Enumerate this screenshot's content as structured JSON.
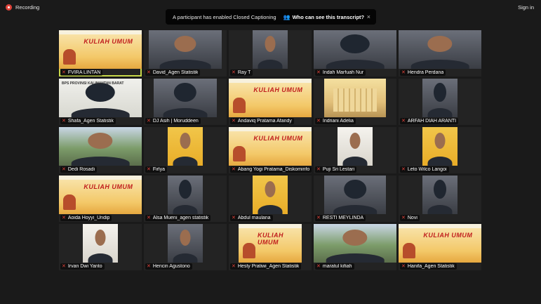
{
  "topbar": {
    "recording_label": "Recording",
    "signin_label": "Sign in"
  },
  "banner": {
    "message": "A participant has enabled Closed Captioning",
    "link_label": "Who can see this transcript?",
    "close_glyph": "×"
  },
  "colors": {
    "background": "#1a1a1a",
    "recording": "#e0433a",
    "active_speaker": "#c8d84a",
    "muted_mic": "#e0433a"
  },
  "icons": {
    "recording": "recording-dot-icon",
    "transcript_link": "people-icon",
    "muted": "microphone-muted-icon"
  },
  "poster": {
    "title": "KULIAH UMUM"
  },
  "bps": {
    "text": "BPS PROVINSI KALIMANTAN BARAT"
  },
  "participants": [
    {
      "name": "FVIRA LINTAN",
      "kind": "poster",
      "active": true
    },
    {
      "name": "David_Agen Statistik",
      "kind": "person"
    },
    {
      "name": "Ray T",
      "kind": "person"
    },
    {
      "name": "Indah Marfuah Nur",
      "kind": "hijab"
    },
    {
      "name": "Hendra Perdana",
      "kind": "person"
    },
    {
      "name": "Shafa_Agen Statistik",
      "kind": "bps"
    },
    {
      "name": "DJ Asih | Moruddeen",
      "kind": "hijab"
    },
    {
      "name": "Andaviq Pratama Afandy",
      "kind": "poster"
    },
    {
      "name": "Indriani Adelia",
      "kind": "building"
    },
    {
      "name": "ARFAH DIAH ARANTI",
      "kind": "hijab"
    },
    {
      "name": "Dedi Rosadi",
      "kind": "outdoor"
    },
    {
      "name": "Firlya",
      "kind": "yellow"
    },
    {
      "name": "Abang Yogi Pratama_Diskominfo",
      "kind": "poster"
    },
    {
      "name": "Puji Sri Lestari",
      "kind": "white"
    },
    {
      "name": "Leto Wilco Langoi",
      "kind": "yellow"
    },
    {
      "name": "Aoida Hoyyi_Undip",
      "kind": "poster"
    },
    {
      "name": "Alsa Mueni_agen statistik",
      "kind": "hijab"
    },
    {
      "name": "Abdul maulana",
      "kind": "yellow"
    },
    {
      "name": "RESTI MEYLINDA",
      "kind": "hijab"
    },
    {
      "name": "Novi",
      "kind": "hijab"
    },
    {
      "name": "Irvan Dwi Yanto",
      "kind": "white"
    },
    {
      "name": "Hencin Agustono",
      "kind": "person"
    },
    {
      "name": "Hesty Pratiwi_Agen Statistik",
      "kind": "poster"
    },
    {
      "name": "maratul kifiah",
      "kind": "outdoor"
    },
    {
      "name": "Hanifa_Agen Statistik",
      "kind": "poster"
    }
  ]
}
